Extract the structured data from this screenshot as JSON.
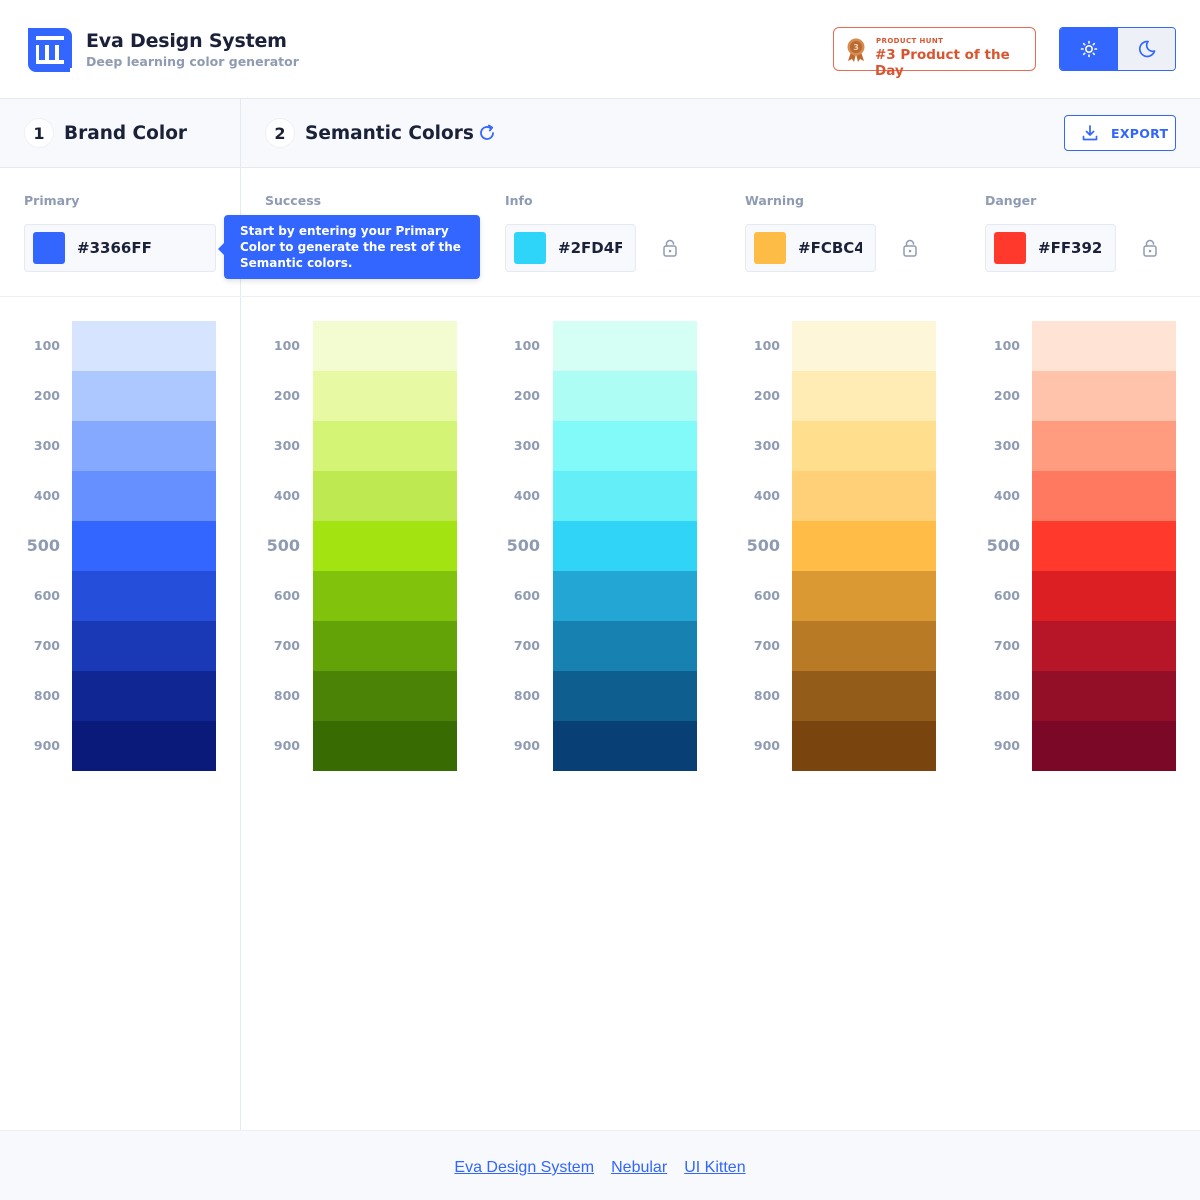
{
  "header": {
    "title": "Eva Design System",
    "subtitle": "Deep learning color generator",
    "product_hunt": {
      "small": "PRODUCT HUNT",
      "big": "#3 Product of the Day",
      "rank": "3"
    }
  },
  "steps": [
    {
      "num": "1",
      "label": "Brand Color"
    },
    {
      "num": "2",
      "label": "Semantic Colors"
    }
  ],
  "export_label": "EXPORT",
  "tooltip": "Start by entering your Primary Color to generate the rest of the Semantic colors.",
  "fields": [
    {
      "label": "Primary",
      "value": "#3366FF",
      "color": "#3366ff"
    },
    {
      "label": "Success",
      "value": "",
      "color": "#95e415"
    },
    {
      "label": "Info",
      "value": "#2FD4F9",
      "color": "#2fd4f9"
    },
    {
      "label": "Warning",
      "value": "#FCBC46",
      "color": "#fcbc46"
    },
    {
      "label": "Danger",
      "value": "#FF392B",
      "color": "#ff392b"
    }
  ],
  "shades": [
    "100",
    "200",
    "300",
    "400",
    "500",
    "600",
    "700",
    "800",
    "900"
  ],
  "palettes": [
    {
      "name": "primary",
      "colors": [
        "#d6e4ff",
        "#adc8ff",
        "#84a9ff",
        "#6690ff",
        "#3366ff",
        "#254edb",
        "#1939b7",
        "#102693",
        "#091a7a"
      ]
    },
    {
      "name": "success",
      "colors": [
        "#f3fcd1",
        "#e7faa3",
        "#d3f474",
        "#bfe950",
        "#a2e311",
        "#81c30c",
        "#64a308",
        "#4a8305",
        "#386c03"
      ]
    },
    {
      "name": "info",
      "colors": [
        "#d5fef5",
        "#adfdf4",
        "#83fafa",
        "#64eef7",
        "#2fd4f7",
        "#23a6d4",
        "#1782b1",
        "#0e5f8f",
        "#083f75"
      ]
    },
    {
      "name": "warning",
      "colors": [
        "#fef6d9",
        "#ffecb4",
        "#ffde8e",
        "#ffd078",
        "#ffbc46",
        "#db9934",
        "#b87a24",
        "#935c18",
        "#7a440e"
      ]
    },
    {
      "name": "danger",
      "colors": [
        "#ffe4d5",
        "#ffc3ab",
        "#ff9c80",
        "#ff7860",
        "#ff392b",
        "#db1f23",
        "#b71628",
        "#930e27",
        "#7a0826"
      ]
    }
  ],
  "footer_links": [
    "Eva Design System",
    "Nebular",
    "UI Kitten"
  ]
}
